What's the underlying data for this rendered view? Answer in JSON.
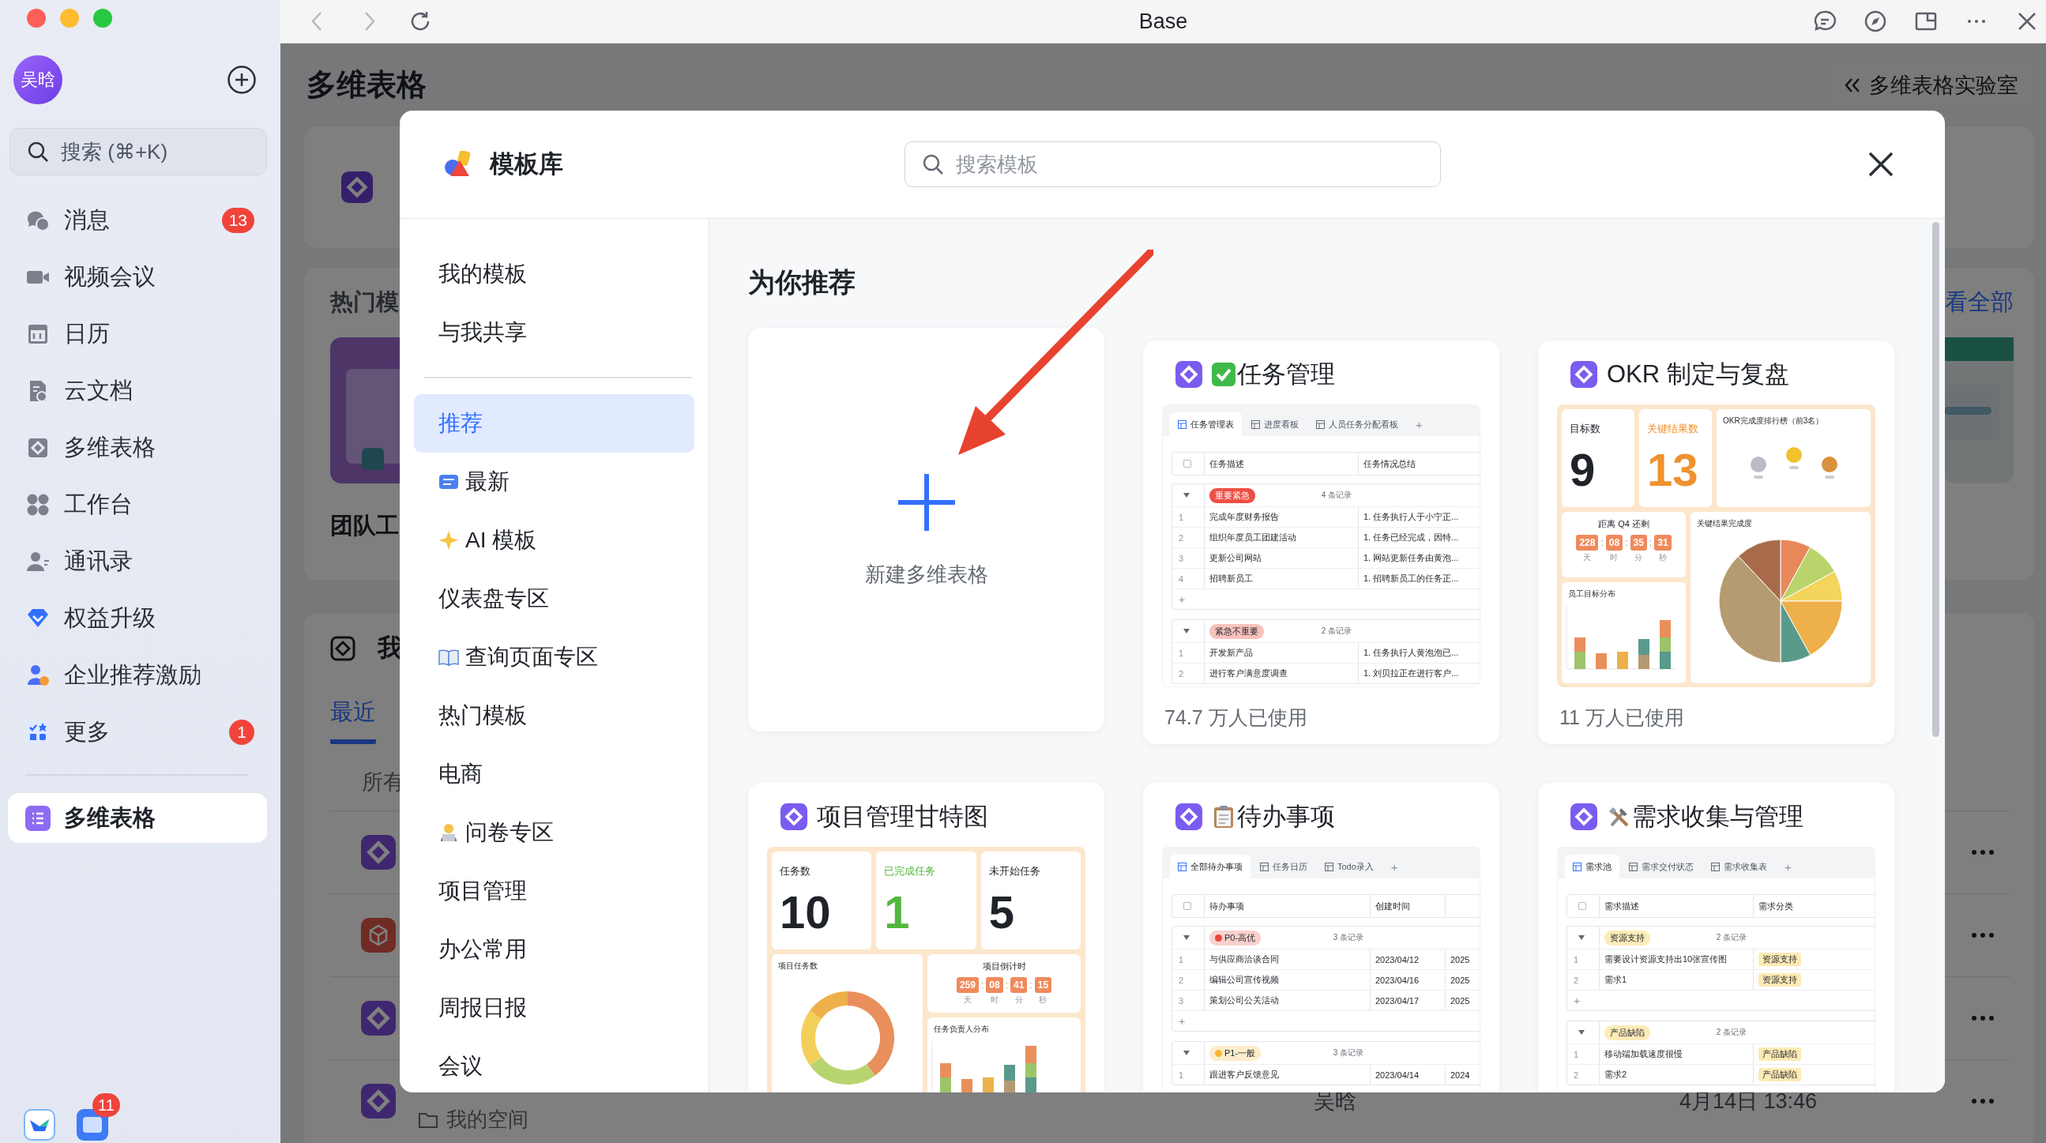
{
  "window": {
    "title": "Base"
  },
  "sidebar": {
    "avatar": "吴晗",
    "search": {
      "placeholder": "搜索 (⌘+K)"
    },
    "items": [
      {
        "label": "消息",
        "badge": "13",
        "selected": false
      },
      {
        "label": "视频会议",
        "selected": false
      },
      {
        "label": "日历",
        "selected": false
      },
      {
        "label": "云文档",
        "selected": false
      },
      {
        "label": "多维表格",
        "selected": false
      },
      {
        "label": "工作台",
        "selected": false
      },
      {
        "label": "通讯录",
        "selected": false
      },
      {
        "label": "权益升级",
        "selected": false
      },
      {
        "label": "企业推荐激励",
        "selected": false
      },
      {
        "label": "更多",
        "badge": "1",
        "selected": false
      }
    ],
    "pinned": [
      {
        "label": "多维表格",
        "selected": true
      }
    ],
    "dock_badge": "11"
  },
  "page": {
    "title": "多维表格",
    "lab_button": "多维表格实验室",
    "hot_title": "热门模",
    "hot_item": "团队工",
    "view_all": "看全部",
    "mine_title": "我",
    "tabs": [
      {
        "label": "最近",
        "selected": true
      }
    ],
    "filter": "所有",
    "rows": [
      {
        "kind": "base"
      },
      {
        "kind": "cube"
      },
      {
        "kind": "base"
      },
      {
        "kind": "base",
        "location": "我的空间",
        "owner": "吴晗",
        "time": "4月14日 13:46"
      }
    ]
  },
  "modal": {
    "title": "模板库",
    "search": {
      "placeholder": "搜索模板"
    },
    "nav_personal": [
      {
        "label": "我的模板",
        "selected": false
      },
      {
        "label": "与我共享",
        "selected": false
      }
    ],
    "nav_categories": [
      {
        "label": "推荐",
        "selected": true
      },
      {
        "label": "最新",
        "selected": false
      },
      {
        "label": "AI 模板",
        "selected": false
      },
      {
        "label": "仪表盘专区",
        "selected": false
      },
      {
        "label": "查询页面专区",
        "selected": false
      },
      {
        "label": "热门模板",
        "selected": false
      },
      {
        "label": "电商",
        "selected": false
      },
      {
        "label": "问卷专区",
        "selected": false
      },
      {
        "label": "项目管理",
        "selected": false
      },
      {
        "label": "办公常用",
        "selected": false
      },
      {
        "label": "周报日报",
        "selected": false
      },
      {
        "label": "会议",
        "selected": false
      }
    ],
    "section_title": "为你推荐",
    "cards": [
      {
        "kind": "new",
        "label": "新建多维表格"
      },
      {
        "kind": "table",
        "title": "任务管理",
        "usage": "74.7 万人已使用",
        "preview": {
          "select_all": {
            "checked": false
          },
          "tabs": [
            {
              "label": "任务管理表",
              "selected": true
            },
            {
              "label": "进度看板",
              "selected": false
            },
            {
              "label": "人员任务分配看板",
              "selected": false
            }
          ],
          "add_tab": "+",
          "columns": [
            {
              "label": "任务描述",
              "kind": "text"
            },
            {
              "label": "任务情况总结",
              "kind": "text"
            }
          ],
          "groups": [
            {
              "tag": "重要紧急",
              "kind": "solid",
              "color": "#ee4f45",
              "count": "4 条记录",
              "add_row": "+",
              "rows": [
                {
                  "no": "1",
                  "cells": [
                    "完成年度财务报告",
                    "1. 任务执行人于小宁正..."
                  ]
                },
                {
                  "no": "2",
                  "cells": [
                    "组织年度员工团建活动",
                    "1. 任务已经完成，因特..."
                  ]
                },
                {
                  "no": "3",
                  "cells": [
                    "更新公司网站",
                    "1. 网站更新任务由黄泡..."
                  ]
                },
                {
                  "no": "4",
                  "cells": [
                    "招聘新员工",
                    "1. 招聘新员工的任务正..."
                  ]
                }
              ]
            },
            {
              "tag": "紧急不重要",
              "kind": "soft",
              "color": "#f8c2bd",
              "count": "2 条记录",
              "rows": [
                {
                  "no": "1",
                  "cells": [
                    "开发新产品",
                    "1. 任务执行人黄泡泡已..."
                  ]
                },
                {
                  "no": "2",
                  "cells": [
                    "进行客户满意度调查",
                    "1. 刘贝拉正在进行客户..."
                  ]
                }
              ]
            }
          ]
        }
      },
      {
        "kind": "dashboard",
        "title": "OKR 制定与复盘",
        "usage": "11 万人已使用",
        "preview": {
          "kind": "okr",
          "tiles": [
            {
              "label": "目标数",
              "value": "9",
              "color": "#1f2329"
            },
            {
              "label": "关键结果数",
              "value": "13",
              "color": "#f0922e"
            }
          ],
          "ranking_title": "OKR完成度排行榜（前3名）",
          "countdown": {
            "title": "距离 Q4 还剩",
            "values": [
              "228",
              "08",
              "35",
              "31"
            ],
            "units": [
              "天",
              "时",
              "分",
              "秒"
            ],
            "separator": ":"
          },
          "bar_title": "员工目标分布",
          "pie_title": "关键结果完成度"
        }
      },
      {
        "kind": "dashboard",
        "title": "项目管理甘特图",
        "preview": {
          "kind": "gantt",
          "tiles": [
            {
              "label": "任务数",
              "value": "10",
              "color": "#1f2329"
            },
            {
              "label": "已完成任务",
              "value": "1",
              "color": "#52b83c"
            },
            {
              "label": "未开始任务",
              "value": "5",
              "color": "#1f2329"
            }
          ],
          "donut_title": "项目任务数",
          "countdown": {
            "title": "项目倒计时",
            "values": [
              "259",
              "08",
              "41",
              "15"
            ],
            "units": [
              "天",
              "时",
              "分",
              "秒"
            ],
            "separator": ":"
          },
          "bar_title": "任务负责人分布"
        }
      },
      {
        "kind": "table",
        "title": "待办事项",
        "preview": {
          "select_all": {
            "checked": false
          },
          "tabs": [
            {
              "label": "全部待办事项",
              "selected": true
            },
            {
              "label": "任务日历",
              "selected": false
            },
            {
              "label": "Todo录入",
              "selected": false
            }
          ],
          "add_tab": "+",
          "columns": [
            {
              "label": "待办事项",
              "kind": "text"
            },
            {
              "label": "创建时间",
              "kind": "text"
            },
            {
              "kind": "text"
            }
          ],
          "groups": [
            {
              "tag": "P0-高优",
              "kind": "dot",
              "color": "#e8453c",
              "count": "3 条记录",
              "add_row": "+",
              "rows": [
                {
                  "no": "1",
                  "cells": [
                    "与供应商洽谈合同",
                    "2023/04/12",
                    "2025"
                  ]
                },
                {
                  "no": "2",
                  "cells": [
                    "编辑公司宣传视频",
                    "2023/04/16",
                    "2025"
                  ]
                },
                {
                  "no": "3",
                  "cells": [
                    "策划公司公关活动",
                    "2023/04/17",
                    "2025"
                  ]
                }
              ]
            },
            {
              "tag": "P1-一般",
              "kind": "dot",
              "color": "#f5b82e",
              "count": "3 条记录",
              "rows": [
                {
                  "no": "1",
                  "cells": [
                    "跟进客户反馈意见",
                    "2023/04/14",
                    "2024"
                  ]
                }
              ]
            }
          ]
        }
      },
      {
        "kind": "table",
        "title": "需求收集与管理",
        "preview": {
          "select_all": {
            "checked": false
          },
          "tabs": [
            {
              "label": "需求池",
              "selected": true
            },
            {
              "label": "需求交付状态",
              "selected": false
            },
            {
              "label": "需求收集表",
              "selected": false
            }
          ],
          "add_tab": "+",
          "columns": [
            {
              "label": "需求描述",
              "kind": "text"
            },
            {
              "label": "需求分类",
              "kind": "tag"
            }
          ],
          "groups": [
            {
              "tag": "资源支持",
              "kind": "soft",
              "color": "#fdebb8",
              "count": "2 条记录",
              "add_row": "+",
              "rows": [
                {
                  "no": "1",
                  "cells": [
                    "需要设计资源支持出10张宣传图",
                    "资源支持"
                  ]
                },
                {
                  "no": "2",
                  "cells": [
                    "需求1",
                    "资源支持"
                  ]
                }
              ]
            },
            {
              "tag": "产品缺陷",
              "kind": "soft",
              "color": "#fdebb8",
              "count": "2 条记录",
              "rows": [
                {
                  "no": "1",
                  "cells": [
                    "移动端加载速度很慢",
                    "产品缺陷"
                  ]
                },
                {
                  "no": "2",
                  "cells": [
                    "需求2",
                    "产品缺陷"
                  ]
                }
              ]
            }
          ]
        }
      }
    ]
  }
}
